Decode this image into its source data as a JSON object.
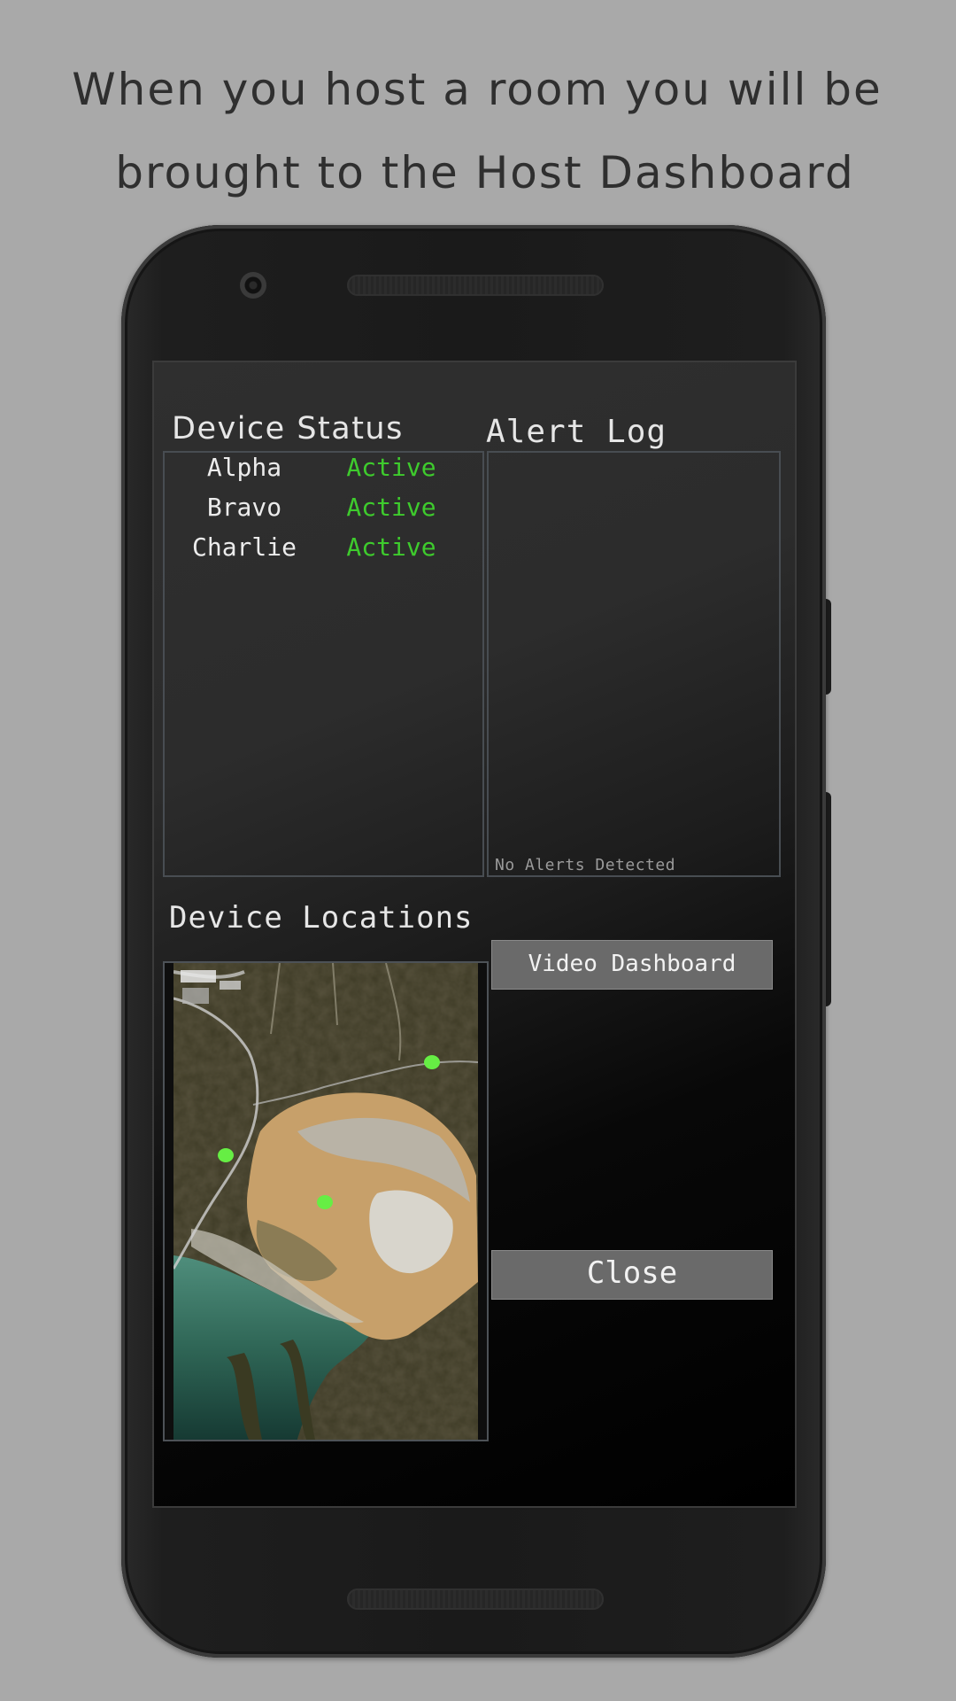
{
  "caption": {
    "line1": "When you host a room you will be",
    "line2": "brought to the Host Dashboard"
  },
  "dashboard": {
    "device_status": {
      "title": "Device Status",
      "devices": [
        {
          "name": "Alpha",
          "status": "Active"
        },
        {
          "name": "Bravo",
          "status": "Active"
        },
        {
          "name": "Charlie",
          "status": "Active"
        }
      ]
    },
    "alert_log": {
      "title": "Alert Log",
      "empty_message": "No Alerts Detected"
    },
    "device_locations": {
      "title": "Device Locations",
      "marker_count": 3
    },
    "buttons": {
      "video_dashboard": "Video Dashboard",
      "close": "Close"
    }
  },
  "colors": {
    "page_background": "#a9a9a9",
    "status_active": "#3ecb2d",
    "button_fill": "#6a6a6a",
    "map_marker": "#66ee44"
  },
  "icons": [
    "camera-icon",
    "speaker-grille-icon",
    "location-marker-icon"
  ]
}
